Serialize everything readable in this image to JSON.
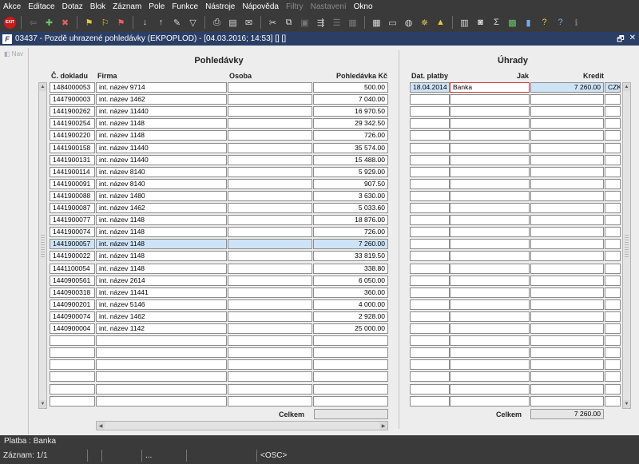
{
  "menu": [
    {
      "label": "Akce",
      "enabled": true
    },
    {
      "label": "Editace",
      "enabled": true
    },
    {
      "label": "Dotaz",
      "enabled": true
    },
    {
      "label": "Blok",
      "enabled": true
    },
    {
      "label": "Záznam",
      "enabled": true
    },
    {
      "label": "Pole",
      "enabled": true
    },
    {
      "label": "Funkce",
      "enabled": true
    },
    {
      "label": "Nástroje",
      "enabled": true
    },
    {
      "label": "Nápověda",
      "enabled": true
    },
    {
      "label": "Filtry",
      "enabled": false
    },
    {
      "label": "Nastavení",
      "enabled": false
    },
    {
      "label": "Okno",
      "enabled": true
    }
  ],
  "toolbar": {
    "exit_label": "EXIT"
  },
  "window": {
    "title": "03437 - Pozdě uhrazené pohledávky (EKPOPLOD) - [04.03.2016; 14:53] [] []",
    "app_icon": "F",
    "restore_glyph": "🗗",
    "close_glyph": "✕"
  },
  "nav": {
    "label": "Nav"
  },
  "pohledavky": {
    "title": "Pohledávky",
    "headers": {
      "doklad": "Č. dokladu",
      "firma": "Firma",
      "osoba": "Osoba",
      "kc": "Pohledávka Kč"
    },
    "rows": [
      {
        "doklad": "1484000053",
        "firma": "int. název 9714",
        "osoba": "",
        "kc": "500.00"
      },
      {
        "doklad": "1447900003",
        "firma": "int. název 1462",
        "osoba": "",
        "kc": "7 040.00"
      },
      {
        "doklad": "1441900262",
        "firma": "int. název 11440",
        "osoba": "",
        "kc": "16 970.50"
      },
      {
        "doklad": "1441900254",
        "firma": "int. název 1148",
        "osoba": "",
        "kc": "29 342.50"
      },
      {
        "doklad": "1441900220",
        "firma": "int. název 1148",
        "osoba": "",
        "kc": "726.00"
      },
      {
        "doklad": "1441900158",
        "firma": "int. název 11440",
        "osoba": "",
        "kc": "35 574.00"
      },
      {
        "doklad": "1441900131",
        "firma": "int. název 11440",
        "osoba": "",
        "kc": "15 488.00"
      },
      {
        "doklad": "1441900114",
        "firma": "int. název 8140",
        "osoba": "",
        "kc": "5 929.00"
      },
      {
        "doklad": "1441900091",
        "firma": "int. název 8140",
        "osoba": "",
        "kc": "907.50"
      },
      {
        "doklad": "1441900088",
        "firma": "int. název 1480",
        "osoba": "",
        "kc": "3 630.00"
      },
      {
        "doklad": "1441900087",
        "firma": "int. název 1462",
        "osoba": "",
        "kc": "5 033.60"
      },
      {
        "doklad": "1441900077",
        "firma": "int. název 1148",
        "osoba": "",
        "kc": "18 876.00"
      },
      {
        "doklad": "1441900074",
        "firma": "int. název 1148",
        "osoba": "",
        "kc": "726.00"
      },
      {
        "doklad": "1441900057",
        "firma": "int. název 1148",
        "osoba": "",
        "kc": "7 260.00",
        "selected": true
      },
      {
        "doklad": "1441900022",
        "firma": "int. název 1148",
        "osoba": "",
        "kc": "33 819.50"
      },
      {
        "doklad": "1441100054",
        "firma": "int. název 1148",
        "osoba": "",
        "kc": "338.80"
      },
      {
        "doklad": "1440900561",
        "firma": "int. název 2614",
        "osoba": "",
        "kc": "6 050.00"
      },
      {
        "doklad": "1440900318",
        "firma": "int. název 11441",
        "osoba": "",
        "kc": "360.00"
      },
      {
        "doklad": "1440900201",
        "firma": "int. název 5146",
        "osoba": "",
        "kc": "4 000.00"
      },
      {
        "doklad": "1440900074",
        "firma": "int. název 1462",
        "osoba": "",
        "kc": "2 928.00"
      },
      {
        "doklad": "1440900004",
        "firma": "int. název 1142",
        "osoba": "",
        "kc": "25 000.00"
      },
      {
        "doklad": "",
        "firma": "",
        "osoba": "",
        "kc": ""
      },
      {
        "doklad": "",
        "firma": "",
        "osoba": "",
        "kc": ""
      },
      {
        "doklad": "",
        "firma": "",
        "osoba": "",
        "kc": ""
      },
      {
        "doklad": "",
        "firma": "",
        "osoba": "",
        "kc": ""
      },
      {
        "doklad": "",
        "firma": "",
        "osoba": "",
        "kc": ""
      },
      {
        "doklad": "",
        "firma": "",
        "osoba": "",
        "kc": ""
      }
    ],
    "sum_label": "Celkem",
    "sum_value": ""
  },
  "uhrady": {
    "title": "Úhrady",
    "headers": {
      "datum": "Dat. platby",
      "jak": "Jak",
      "kredit": "Kredit"
    },
    "rows": [
      {
        "datum": "18.04.2014",
        "jak": "Banka",
        "kredit": "7 260.00",
        "mena": "CZK",
        "selected": true
      },
      {
        "datum": "",
        "jak": "",
        "kredit": "",
        "mena": ""
      },
      {
        "datum": "",
        "jak": "",
        "kredit": "",
        "mena": ""
      },
      {
        "datum": "",
        "jak": "",
        "kredit": "",
        "mena": ""
      },
      {
        "datum": "",
        "jak": "",
        "kredit": "",
        "mena": ""
      },
      {
        "datum": "",
        "jak": "",
        "kredit": "",
        "mena": ""
      },
      {
        "datum": "",
        "jak": "",
        "kredit": "",
        "mena": ""
      },
      {
        "datum": "",
        "jak": "",
        "kredit": "",
        "mena": ""
      },
      {
        "datum": "",
        "jak": "",
        "kredit": "",
        "mena": ""
      },
      {
        "datum": "",
        "jak": "",
        "kredit": "",
        "mena": ""
      },
      {
        "datum": "",
        "jak": "",
        "kredit": "",
        "mena": ""
      },
      {
        "datum": "",
        "jak": "",
        "kredit": "",
        "mena": ""
      },
      {
        "datum": "",
        "jak": "",
        "kredit": "",
        "mena": ""
      },
      {
        "datum": "",
        "jak": "",
        "kredit": "",
        "mena": ""
      },
      {
        "datum": "",
        "jak": "",
        "kredit": "",
        "mena": ""
      },
      {
        "datum": "",
        "jak": "",
        "kredit": "",
        "mena": ""
      },
      {
        "datum": "",
        "jak": "",
        "kredit": "",
        "mena": ""
      },
      {
        "datum": "",
        "jak": "",
        "kredit": "",
        "mena": ""
      },
      {
        "datum": "",
        "jak": "",
        "kredit": "",
        "mena": ""
      },
      {
        "datum": "",
        "jak": "",
        "kredit": "",
        "mena": ""
      },
      {
        "datum": "",
        "jak": "",
        "kredit": "",
        "mena": ""
      },
      {
        "datum": "",
        "jak": "",
        "kredit": "",
        "mena": ""
      },
      {
        "datum": "",
        "jak": "",
        "kredit": "",
        "mena": ""
      },
      {
        "datum": "",
        "jak": "",
        "kredit": "",
        "mena": ""
      },
      {
        "datum": "",
        "jak": "",
        "kredit": "",
        "mena": ""
      },
      {
        "datum": "",
        "jak": "",
        "kredit": "",
        "mena": ""
      },
      {
        "datum": "",
        "jak": "",
        "kredit": "",
        "mena": ""
      }
    ],
    "sum_label": "Celkem",
    "sum_value": "7 260.00"
  },
  "status": {
    "line1": "Platba : Banka",
    "record": "Záznam: 1/1",
    "seg2": "",
    "seg3": "",
    "seg4": "...",
    "seg5": "",
    "osc": "<OSC>"
  },
  "colors": {
    "title_bar": "#2b3f66",
    "selected_row": "#cfe3f7",
    "focus_border": "#d03a3a"
  }
}
